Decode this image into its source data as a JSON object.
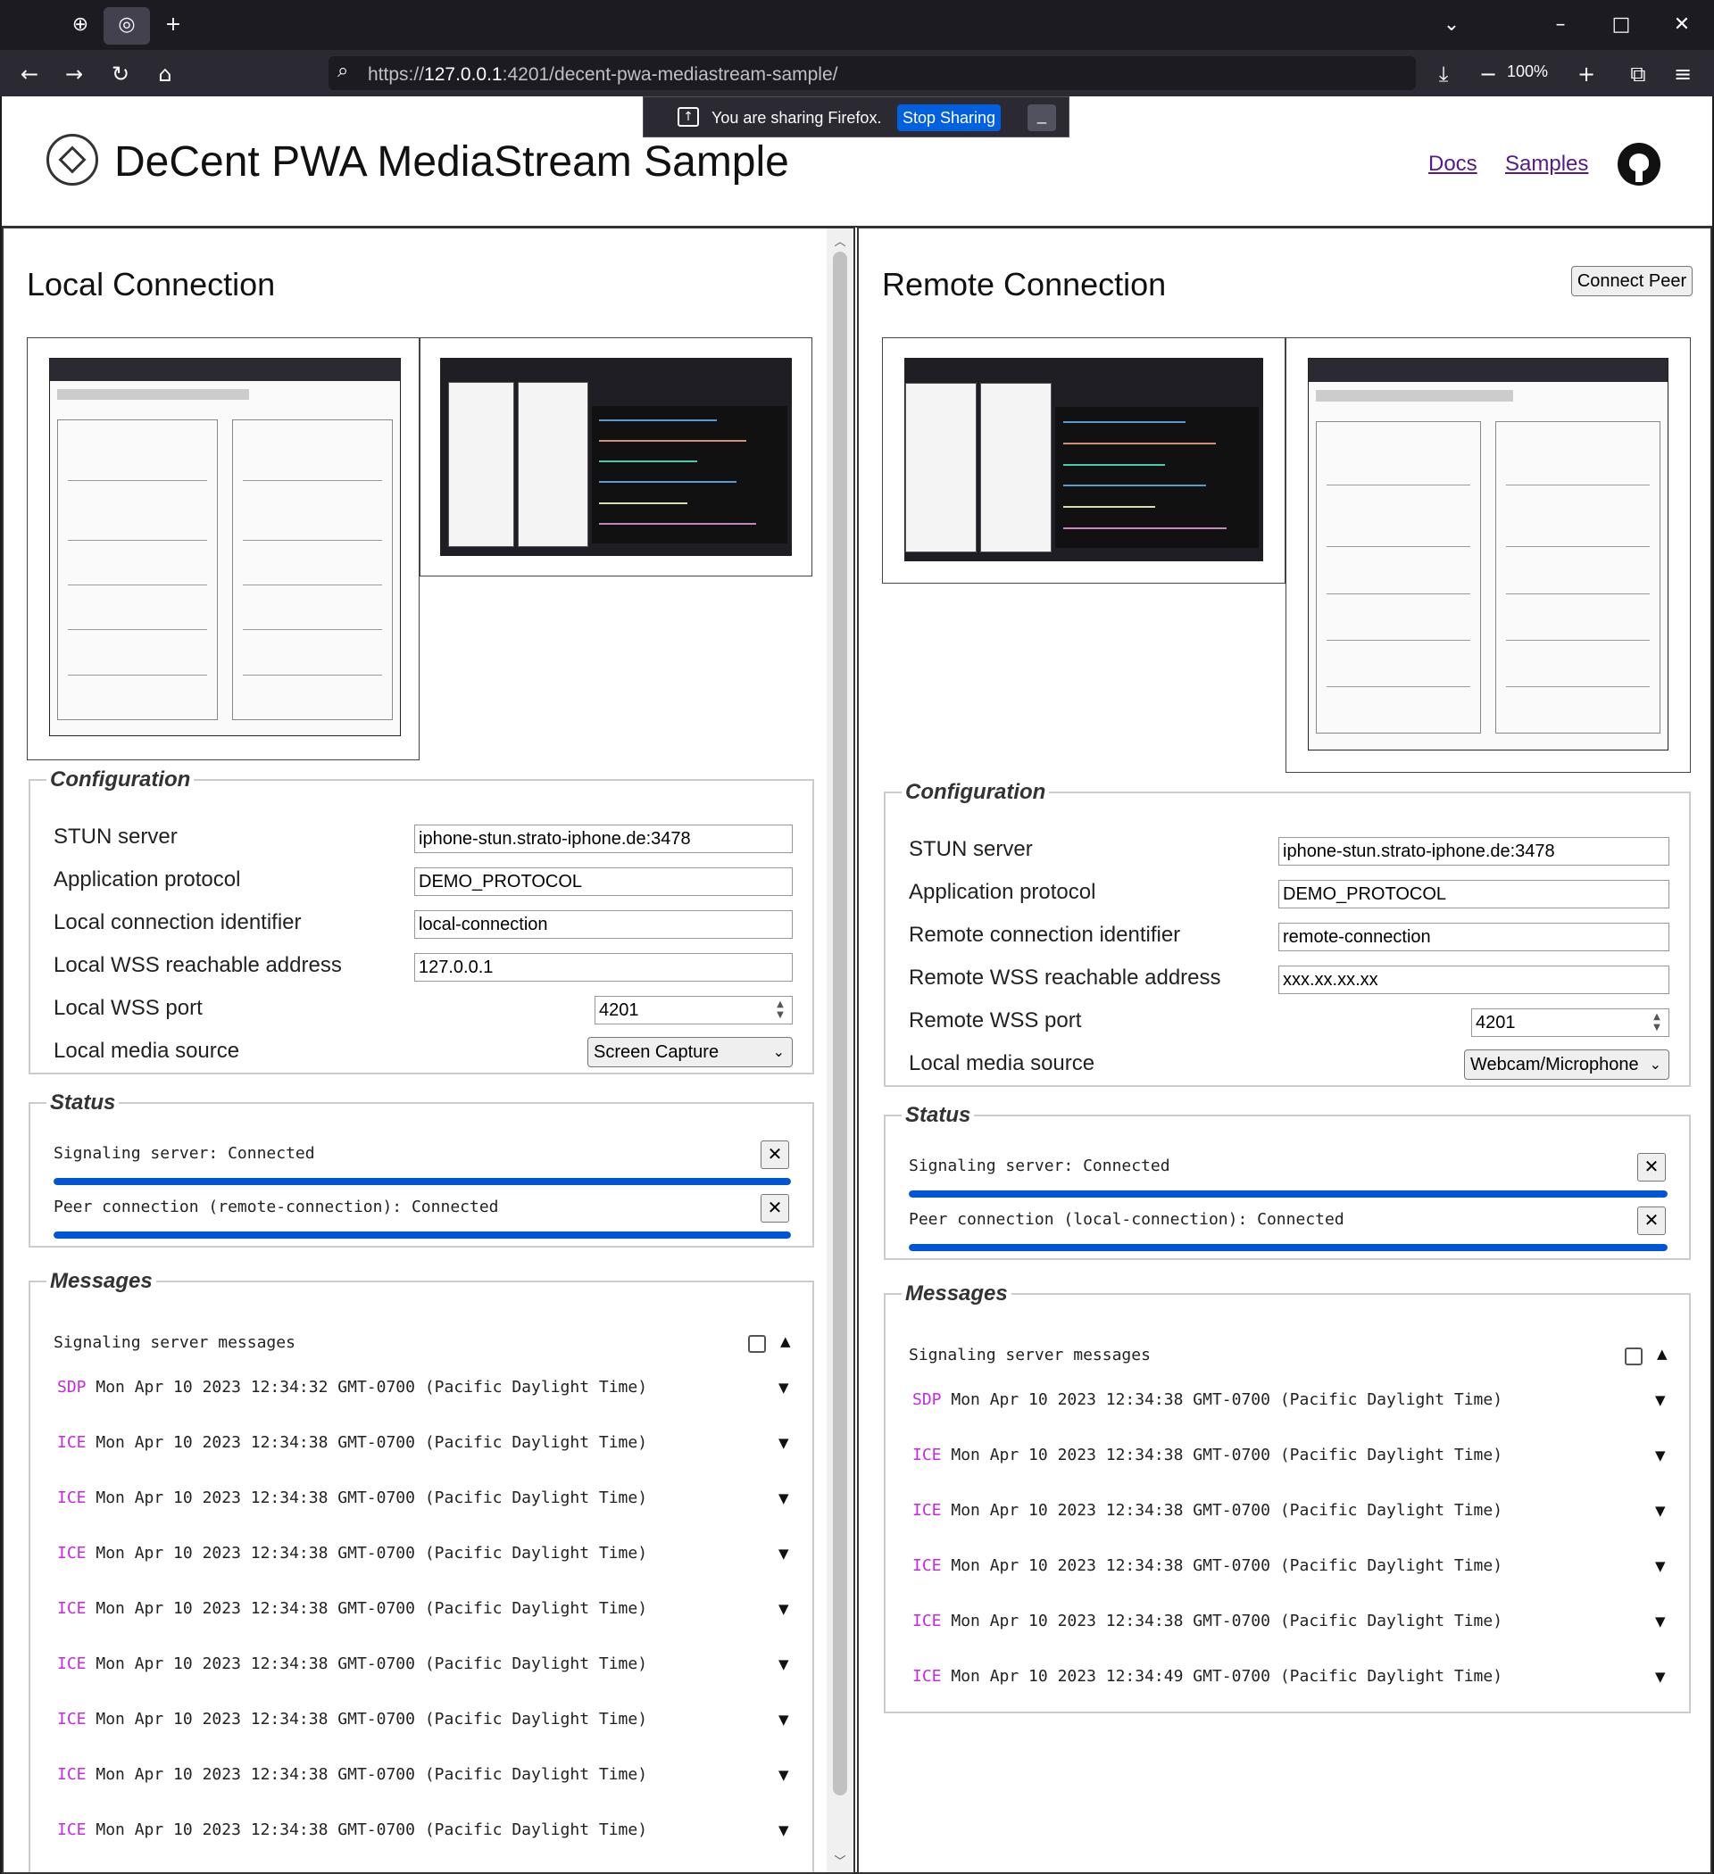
{
  "browser": {
    "url_prefix": "https://",
    "url_host": "127.0.0.1",
    "url_rest": ":4201/decent-pwa-mediastream-sample/",
    "zoom": "100%",
    "share_text": "You are sharing Firefox.",
    "stop_sharing": "Stop Sharing"
  },
  "header": {
    "title": "DeCent PWA MediaStream Sample",
    "nav_docs": "Docs",
    "nav_samples": "Samples"
  },
  "local": {
    "title": "Local Connection",
    "config_legend": "Configuration",
    "fields": [
      {
        "label": "STUN server",
        "value": "iphone-stun.strato-iphone.de:3478"
      },
      {
        "label": "Application protocol",
        "value": "DEMO_PROTOCOL"
      },
      {
        "label": "Local connection identifier",
        "value": "local-connection"
      },
      {
        "label": "Local WSS reachable address",
        "value": "127.0.0.1"
      },
      {
        "label": "Local WSS port",
        "value": "4201"
      },
      {
        "label": "Local media source",
        "value": "Screen Capture"
      }
    ],
    "status_legend": "Status",
    "status": [
      {
        "text": "Signaling server: Connected",
        "progress": 1.0
      },
      {
        "text": "Peer connection (remote-connection): Connected",
        "progress": 1.0
      }
    ],
    "messages_legend": "Messages",
    "messages_header": "Signaling server messages",
    "messages": [
      {
        "type": "SDP",
        "time": "Mon Apr 10 2023 12:34:32 GMT-0700 (Pacific Daylight Time)"
      },
      {
        "type": "ICE",
        "time": "Mon Apr 10 2023 12:34:38 GMT-0700 (Pacific Daylight Time)"
      },
      {
        "type": "ICE",
        "time": "Mon Apr 10 2023 12:34:38 GMT-0700 (Pacific Daylight Time)"
      },
      {
        "type": "ICE",
        "time": "Mon Apr 10 2023 12:34:38 GMT-0700 (Pacific Daylight Time)"
      },
      {
        "type": "ICE",
        "time": "Mon Apr 10 2023 12:34:38 GMT-0700 (Pacific Daylight Time)"
      },
      {
        "type": "ICE",
        "time": "Mon Apr 10 2023 12:34:38 GMT-0700 (Pacific Daylight Time)"
      },
      {
        "type": "ICE",
        "time": "Mon Apr 10 2023 12:34:38 GMT-0700 (Pacific Daylight Time)"
      },
      {
        "type": "ICE",
        "time": "Mon Apr 10 2023 12:34:38 GMT-0700 (Pacific Daylight Time)"
      },
      {
        "type": "ICE",
        "time": "Mon Apr 10 2023 12:34:38 GMT-0700 (Pacific Daylight Time)"
      }
    ]
  },
  "remote": {
    "title": "Remote Connection",
    "connect_button": "Connect Peer",
    "config_legend": "Configuration",
    "fields": [
      {
        "label": "STUN server",
        "value": "iphone-stun.strato-iphone.de:3478"
      },
      {
        "label": "Application protocol",
        "value": "DEMO_PROTOCOL"
      },
      {
        "label": "Remote connection identifier",
        "value": "remote-connection"
      },
      {
        "label": "Remote WSS reachable address",
        "value": "xxx.xx.xx.xx"
      },
      {
        "label": "Remote WSS port",
        "value": "4201"
      },
      {
        "label": "Local media source",
        "value": "Webcam/Microphone"
      }
    ],
    "status_legend": "Status",
    "status": [
      {
        "text": "Signaling server: Connected",
        "progress": 1.0
      },
      {
        "text": "Peer connection (local-connection): Connected",
        "progress": 1.0
      }
    ],
    "messages_legend": "Messages",
    "messages_header": "Signaling server messages",
    "messages": [
      {
        "type": "SDP",
        "time": "Mon Apr 10 2023 12:34:38 GMT-0700 (Pacific Daylight Time)"
      },
      {
        "type": "ICE",
        "time": "Mon Apr 10 2023 12:34:38 GMT-0700 (Pacific Daylight Time)"
      },
      {
        "type": "ICE",
        "time": "Mon Apr 10 2023 12:34:38 GMT-0700 (Pacific Daylight Time)"
      },
      {
        "type": "ICE",
        "time": "Mon Apr 10 2023 12:34:38 GMT-0700 (Pacific Daylight Time)"
      },
      {
        "type": "ICE",
        "time": "Mon Apr 10 2023 12:34:38 GMT-0700 (Pacific Daylight Time)"
      },
      {
        "type": "ICE",
        "time": "Mon Apr 10 2023 12:34:49 GMT-0700 (Pacific Daylight Time)"
      }
    ]
  },
  "colors": {
    "accent": "#0055d4",
    "message_type": "#c729e0",
    "link": "#551a8b"
  },
  "icons": [
    "firefox-view-icon",
    "globe-icon",
    "new-tab-icon",
    "tab-list-icon",
    "back-icon",
    "forward-icon",
    "reload-icon",
    "home-icon",
    "search-icon",
    "download-icon",
    "zoom-out-icon",
    "zoom-in-icon",
    "extensions-icon",
    "menu-icon",
    "share-icon",
    "github-icon",
    "logo-icon",
    "close-icon",
    "chevron-down-icon",
    "collapse-icon",
    "expand-icon"
  ]
}
